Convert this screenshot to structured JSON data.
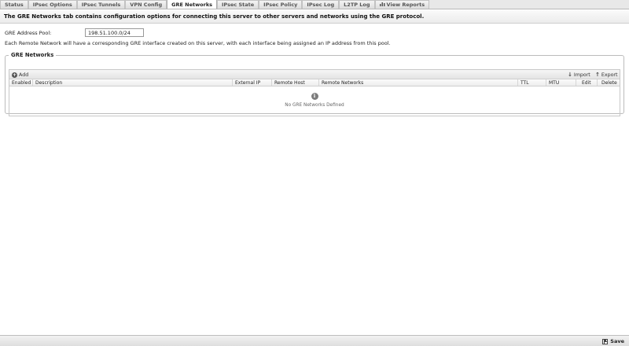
{
  "tabs": [
    {
      "label": "Status",
      "active": false
    },
    {
      "label": "IPsec Options",
      "active": false
    },
    {
      "label": "IPsec Tunnels",
      "active": false
    },
    {
      "label": "VPN Config",
      "active": false
    },
    {
      "label": "GRE Networks",
      "active": true
    },
    {
      "label": "IPsec State",
      "active": false
    },
    {
      "label": "IPsec Policy",
      "active": false
    },
    {
      "label": "IPsec Log",
      "active": false
    },
    {
      "label": "L2TP Log",
      "active": false
    },
    {
      "label": "View Reports",
      "active": false,
      "icon": "bar-chart-icon"
    }
  ],
  "heading": "The GRE Networks tab contains configuration options for connecting this server to other servers and networks using the GRE protocol.",
  "pool": {
    "label": "GRE Address Pool:",
    "value": "198.51.100.0/24",
    "description": "Each Remote Network will have a corresponding GRE interface created on this server, with each interface being assigned an IP address from this pool."
  },
  "gre_networks": {
    "legend": "GRE Networks",
    "toolbar": {
      "add_label": "Add",
      "import_label": "Import",
      "export_label": "Export"
    },
    "columns": [
      "Enabled",
      "Description",
      "External IP",
      "Remote Host",
      "Remote Networks",
      "TTL",
      "MTU",
      "Edit",
      "Delete"
    ],
    "empty_text": "No GRE Networks Defined"
  },
  "footer": {
    "save_label": "Save"
  },
  "icons": {
    "add": "plus-circle-icon",
    "import": "arrow-down-icon",
    "export": "arrow-up-icon",
    "info": "info-icon",
    "save": "disk-icon"
  }
}
